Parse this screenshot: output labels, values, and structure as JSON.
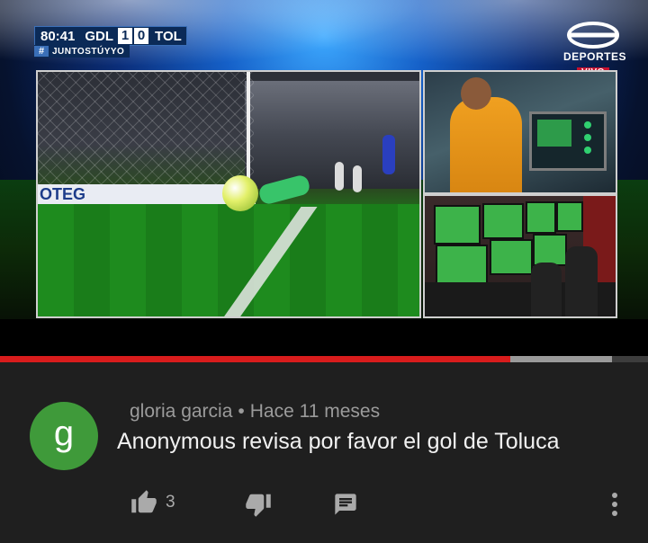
{
  "video": {
    "scoreboard": {
      "time": "80:41",
      "home_team": "GDL",
      "home_score": "1",
      "away_score": "0",
      "away_team": "TOL"
    },
    "hashtag": "JUNTOSTÚYYO",
    "broadcaster": {
      "name": "DEPORTES",
      "live_badge": "VIVO"
    },
    "ad_board_text": "OTEG",
    "progress": {
      "played_fraction": 0.787,
      "buffered_fraction": 0.157
    }
  },
  "comment": {
    "avatar_letter": "g",
    "avatar_color": "#3f9a3a",
    "author": "gloria garcia",
    "separator": "•",
    "time_ago": "Hace 11 meses",
    "text": "Anonymous revisa por favor el gol de Toluca",
    "like_count": "3"
  },
  "colors": {
    "background": "#1f1f1f",
    "progress_played": "#d81c1c",
    "vivo_badge": "#c8102e"
  }
}
